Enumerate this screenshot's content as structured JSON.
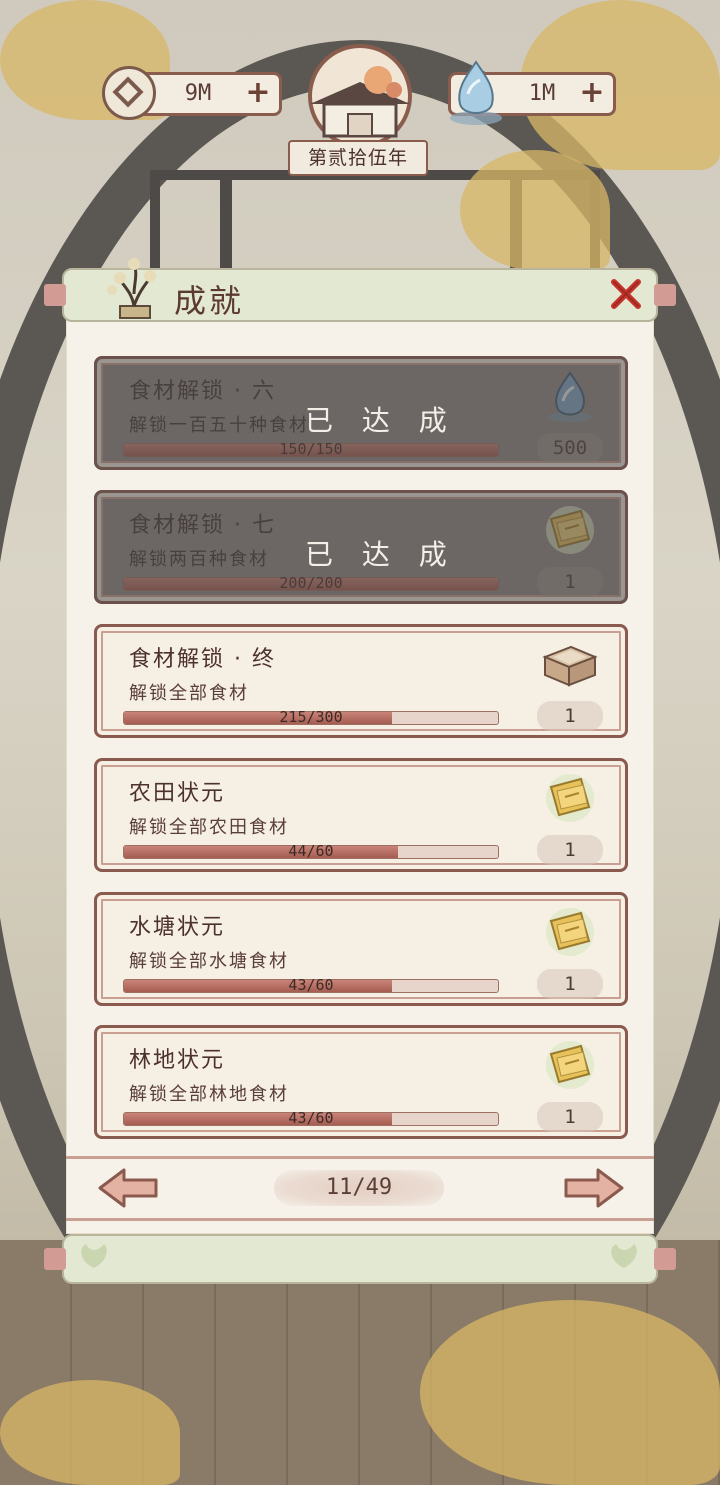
{
  "hud": {
    "coins": "9M",
    "water": "1M",
    "year": "第贰拾伍年"
  },
  "panel": {
    "title": "成就"
  },
  "achievements": [
    {
      "name": "食材解锁 · 六",
      "desc": "解锁一百五十种食材",
      "progress_text": "150/150",
      "progress": 1.0,
      "reward": "500",
      "reward_icon": "water-drop-icon",
      "status": "已 达 成",
      "completed": true
    },
    {
      "name": "食材解锁 · 七",
      "desc": "解锁两百种食材",
      "progress_text": "200/200",
      "progress": 1.0,
      "reward": "1",
      "reward_icon": "golden-ticket-icon",
      "status": "已 达 成",
      "completed": true
    },
    {
      "name": "食材解锁 · 终",
      "desc": "解锁全部食材",
      "progress_text": "215/300",
      "progress": 0.717,
      "reward": "1",
      "reward_icon": "wooden-chest-icon",
      "status": "",
      "completed": false
    },
    {
      "name": "农田状元",
      "desc": "解锁全部农田食材",
      "progress_text": "44/60",
      "progress": 0.733,
      "reward": "1",
      "reward_icon": "golden-ticket-icon",
      "status": "",
      "completed": false
    },
    {
      "name": "水塘状元",
      "desc": "解锁全部水塘食材",
      "progress_text": "43/60",
      "progress": 0.717,
      "reward": "1",
      "reward_icon": "golden-ticket-icon",
      "status": "",
      "completed": false
    },
    {
      "name": "林地状元",
      "desc": "解锁全部林地食材",
      "progress_text": "43/60",
      "progress": 0.717,
      "reward": "1",
      "reward_icon": "golden-ticket-icon",
      "status": "",
      "completed": false
    }
  ],
  "pager": {
    "current": "11/49"
  },
  "colors": {
    "frame": "#8a5a4f",
    "progress_fill": "#b56d62",
    "card_bg": "#f5efe4",
    "completed_overlay": "#6f6a66"
  }
}
